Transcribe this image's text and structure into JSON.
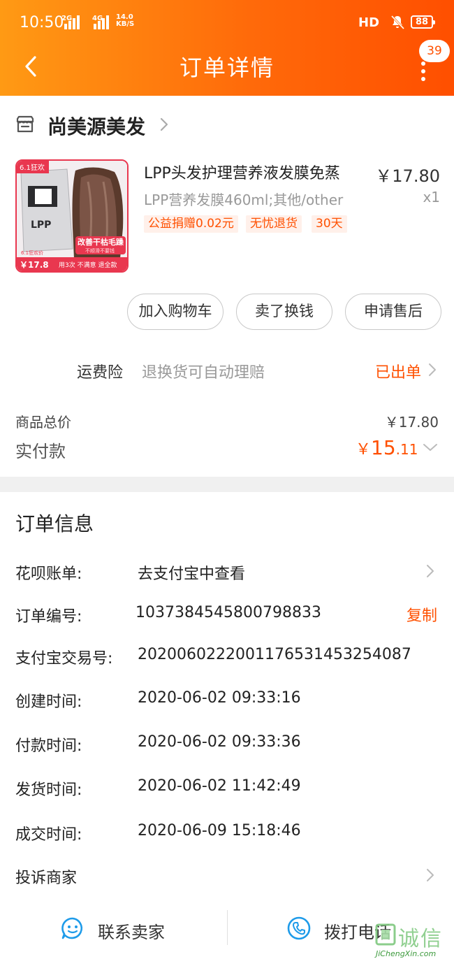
{
  "status_bar": {
    "time": "10:50",
    "net1": "2G",
    "net2": "4G",
    "speed_top": "14.0",
    "speed_bottom": "KB/S",
    "hd": "HD",
    "battery": "88"
  },
  "header": {
    "title": "订单详情",
    "message_badge": "39",
    "back_icon": "chevron-left-icon",
    "more_icon": "more-vertical-icon"
  },
  "shop": {
    "name": "尚美源美发",
    "icon": "store-icon"
  },
  "product": {
    "title": "LPP头发护理营养液发膜免蒸",
    "price": "￥17.80",
    "sku": "LPP营养发膜460ml;其他/other",
    "quantity": "x1",
    "tags": [
      "公益捐赠0.02元",
      "无忧退货",
      "30天"
    ],
    "image": {
      "corner_badge": "6.1狂欢",
      "banner": "改善干枯毛躁",
      "banner_sub": "不顺滑不要钱",
      "promo_label": "6.1狂欢价",
      "promo_price": "￥17.8",
      "footer": "用3次 不满意 退全款",
      "pack_text": "LPP"
    }
  },
  "actions": {
    "add_to_cart": "加入购物车",
    "resell": "卖了换钱",
    "after_sales": "申请售后"
  },
  "freight": {
    "label": "运费险",
    "desc": "退换货可自动理赔",
    "status": "已出单"
  },
  "totals": {
    "subtotal_label": "商品总价",
    "subtotal_value": "￥17.80",
    "paid_label": "实付款",
    "paid_symbol": "￥",
    "paid_int": "15",
    "paid_dec": ".11"
  },
  "order_info": {
    "title": "订单信息",
    "huabei_label": "花呗账单:",
    "huabei_value": "去支付宝中查看",
    "order_no_label": "订单编号:",
    "order_no_value": "1037384545800798833",
    "copy_label": "复制",
    "alipay_no_label": "支付宝交易号:",
    "alipay_no_value": "2020060222001176531453254087",
    "created_label": "创建时间:",
    "created_value": "2020-06-02 09:33:16",
    "paid_time_label": "付款时间:",
    "paid_time_value": "2020-06-02 09:33:36",
    "shipped_label": "发货时间:",
    "shipped_value": "2020-06-02 11:42:49",
    "completed_label": "成交时间:",
    "completed_value": "2020-06-09 15:18:46",
    "complaint_label": "投诉商家"
  },
  "bottom_bar": {
    "contact_seller": "联系卖家",
    "call_phone": "拨打电话"
  },
  "watermark": {
    "main": "诚信",
    "sub": "JiChengXin.com"
  },
  "colors": {
    "accent": "#ff5000",
    "header_start": "#ff9a14",
    "header_end": "#ff4f00",
    "icon_blue": "#1e9be9"
  }
}
